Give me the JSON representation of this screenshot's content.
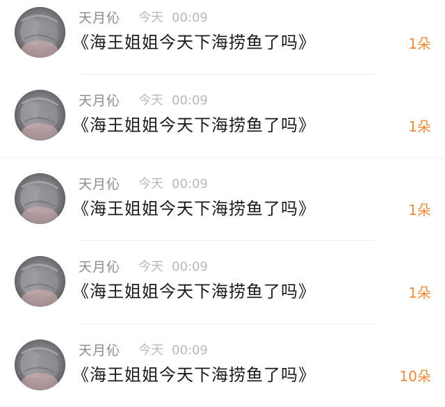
{
  "accent_color": "#f08a3a",
  "comments": [
    {
      "avatar_icon": "cat-paw-avatar",
      "username": "天月伈",
      "time_day": "今天",
      "time_clock": "00:09",
      "message": "《海王姐姐今天下海捞鱼了吗》",
      "gift_count": "1朵"
    },
    {
      "avatar_icon": "cat-paw-avatar",
      "username": "天月伈",
      "time_day": "今天",
      "time_clock": "00:09",
      "message": "《海王姐姐今天下海捞鱼了吗》",
      "gift_count": "1朵"
    },
    {
      "avatar_icon": "cat-paw-avatar",
      "username": "天月伈",
      "time_day": "今天",
      "time_clock": "00:09",
      "message": "《海王姐姐今天下海捞鱼了吗》",
      "gift_count": "1朵"
    },
    {
      "avatar_icon": "cat-paw-avatar",
      "username": "天月伈",
      "time_day": "今天",
      "time_clock": "00:09",
      "message": "《海王姐姐今天下海捞鱼了吗》",
      "gift_count": "1朵"
    },
    {
      "avatar_icon": "cat-paw-avatar",
      "username": "天月伈",
      "time_day": "今天",
      "time_clock": "00:09",
      "message": "《海王姐姐今天下海捞鱼了吗》",
      "gift_count": "10朵"
    }
  ]
}
